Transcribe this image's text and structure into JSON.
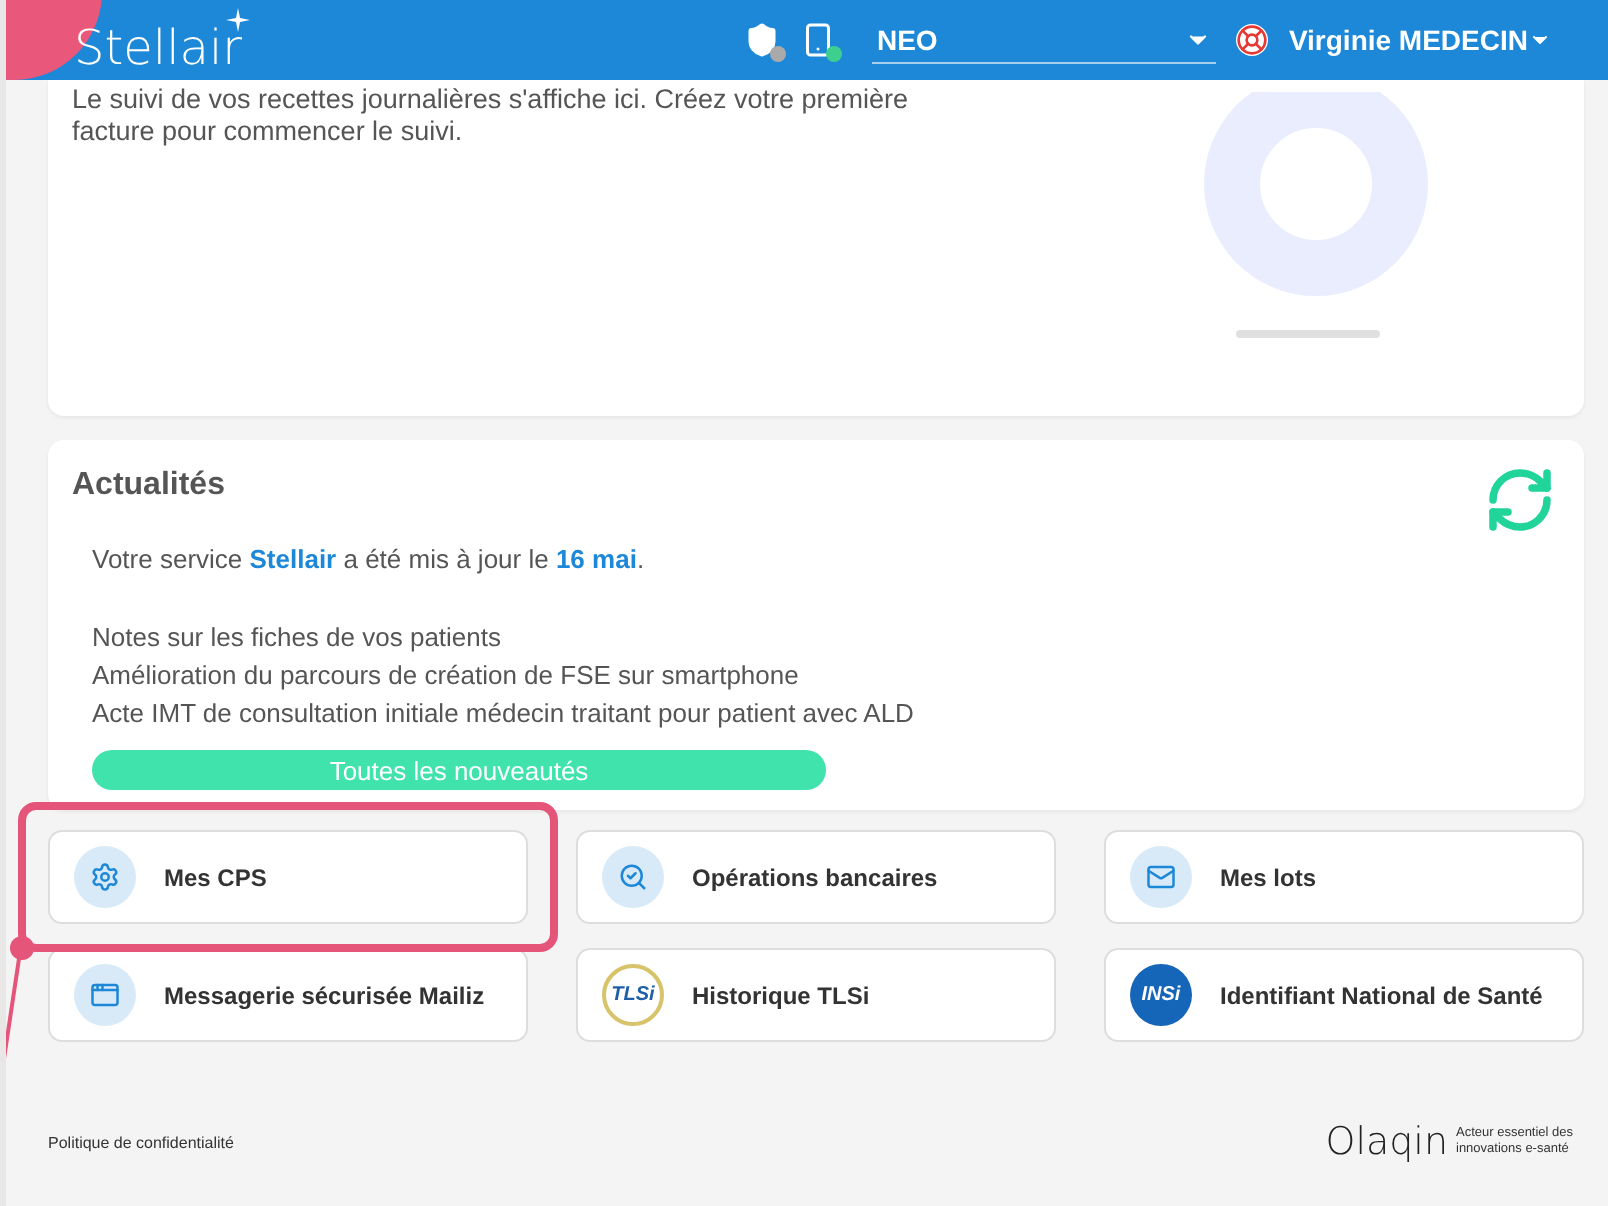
{
  "header": {
    "logo": "Stellair",
    "practice_select": {
      "value": "NEO"
    },
    "user": {
      "name": "Virginie MEDECIN"
    }
  },
  "revenue_card": {
    "message": "Le suivi de vos recettes journalières s'affiche ici. Créez votre première facture pour commencer le suivi."
  },
  "news": {
    "title": "Actualités",
    "intro": "Votre service **Stellair** a été mis à jour le **16 mai**.",
    "items": [
      "Notes sur les fiches de vos patients",
      "Amélioration du parcours de création de FSE sur smartphone",
      "Acte IMT de consultation initiale médecin traitant pour patient avec ALD"
    ],
    "button": "Toutes les nouveautés"
  },
  "shortcuts": [
    {
      "label": "Mes CPS",
      "kind": "gear",
      "highlighted": true
    },
    {
      "label": "Opérations bancaires",
      "kind": "bank",
      "highlighted": false
    },
    {
      "label": "Mes lots",
      "kind": "mail",
      "highlighted": false
    },
    {
      "label": "Messagerie sécurisée Mailiz",
      "kind": "message",
      "highlighted": false
    },
    {
      "label": "Historique TLSi",
      "kind": "tlsi",
      "logo_text": "TLSi",
      "highlighted": false
    },
    {
      "label": "Identifiant National de Santé",
      "kind": "ins",
      "logo_text": "INSi",
      "highlighted": false
    }
  ],
  "footer": {
    "privacy_link": "Politique de confidentialité",
    "brand": "Olaqin",
    "tagline": "Acteur essentiel des innovations e-santé"
  }
}
